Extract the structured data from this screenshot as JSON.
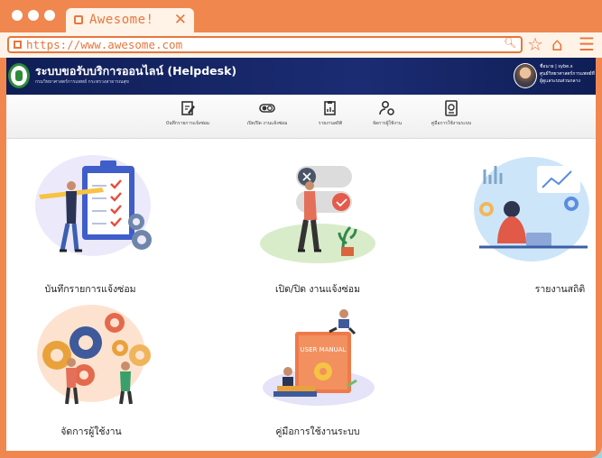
{
  "browser": {
    "tab_title": "Awesome!",
    "url": "https://www.awesome.com"
  },
  "header": {
    "title": "ระบบขอรับบริการออนไลน์ (Helpdesk)",
    "subtitle": "กรมวิทยาศาสตร์การแพทย์ กระทรวงสาธารณสุข",
    "user_lines": [
      "ชื่อนาย | sybe.s",
      "ศูนย์วิทยาศาสตร์การแพทย์ที่ 1",
      "ผู้ดูแลระบบส่วนกลาง"
    ]
  },
  "menu": [
    {
      "label": "บันทึกรายการแจ้งซ่อม",
      "icon": "edit-document-icon"
    },
    {
      "label": "เปิด/ปิด งานแจ้งซ่อม",
      "icon": "toggle-icon"
    },
    {
      "label": "รายงานสถิติ",
      "icon": "report-icon"
    },
    {
      "label": "จัดการผู้ใช้งาน",
      "icon": "user-settings-icon"
    },
    {
      "label": "คู่มือการใช้งานระบบ",
      "icon": "manual-icon"
    }
  ],
  "cards": [
    {
      "label": "บันทึกรายการแจ้งซ่อม"
    },
    {
      "label": "เปิด/ปิด งานแจ้งซ่อม"
    },
    {
      "label": "รายงานสถิติ"
    },
    {
      "label": "จัดการผู้ใช้งาน"
    },
    {
      "label": "คู่มือการใช้งานระบบ"
    }
  ],
  "illustration_text": {
    "manual_book": "USER MANUAL"
  },
  "colors": {
    "frame": "#f0874f",
    "accent": "#e8773d",
    "header": "#1b2c73",
    "background": "#9fd4e4"
  }
}
